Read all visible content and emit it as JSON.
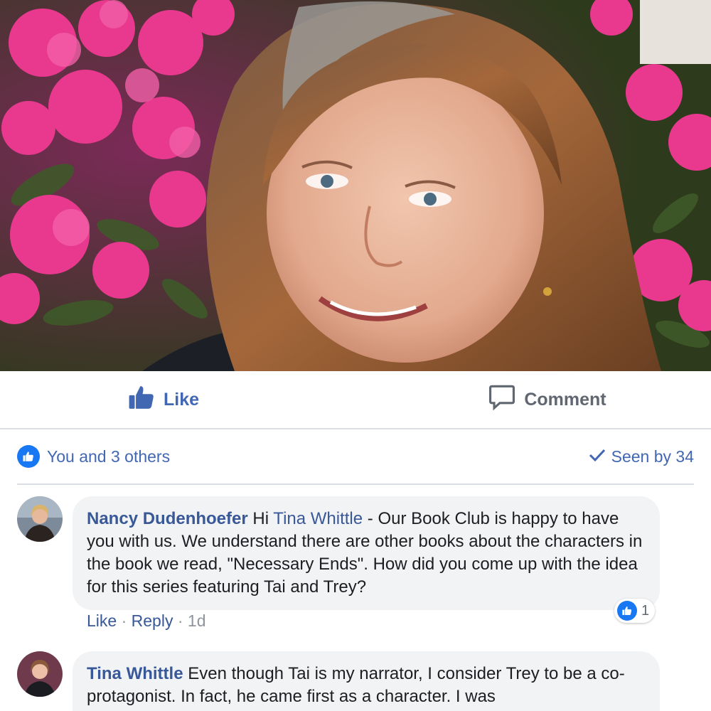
{
  "post": {
    "photo_alt": "profile-photo",
    "actions": {
      "like_label": "Like",
      "comment_label": "Comment"
    },
    "reactions": {
      "summary": "You and 3 others",
      "seen_by": "Seen by 34"
    }
  },
  "comments": [
    {
      "author": "Nancy Dudenhoefer",
      "text_prefix": "Hi ",
      "mention": "Tina Whittle",
      "text": " - Our Book Club is happy to have you with us. We understand there are other books about the characters in the book we read, \"Necessary Ends\". How did you come up with the idea for this series featuring Tai and Trey?",
      "like_label": "Like",
      "reply_label": "Reply",
      "separator": "·",
      "time": "1d",
      "reaction_count": "1"
    },
    {
      "author": "Tina Whittle",
      "text": "Even though Tai is my narrator, I consider Trey to be a co-protagonist. In fact, he came first as a character. I was"
    }
  ],
  "colors": {
    "link_blue": "#4267b2",
    "name_blue": "#385898",
    "bubble_bg": "#f2f3f5",
    "divider": "#dadde1",
    "like_badge": "#1877f2"
  }
}
